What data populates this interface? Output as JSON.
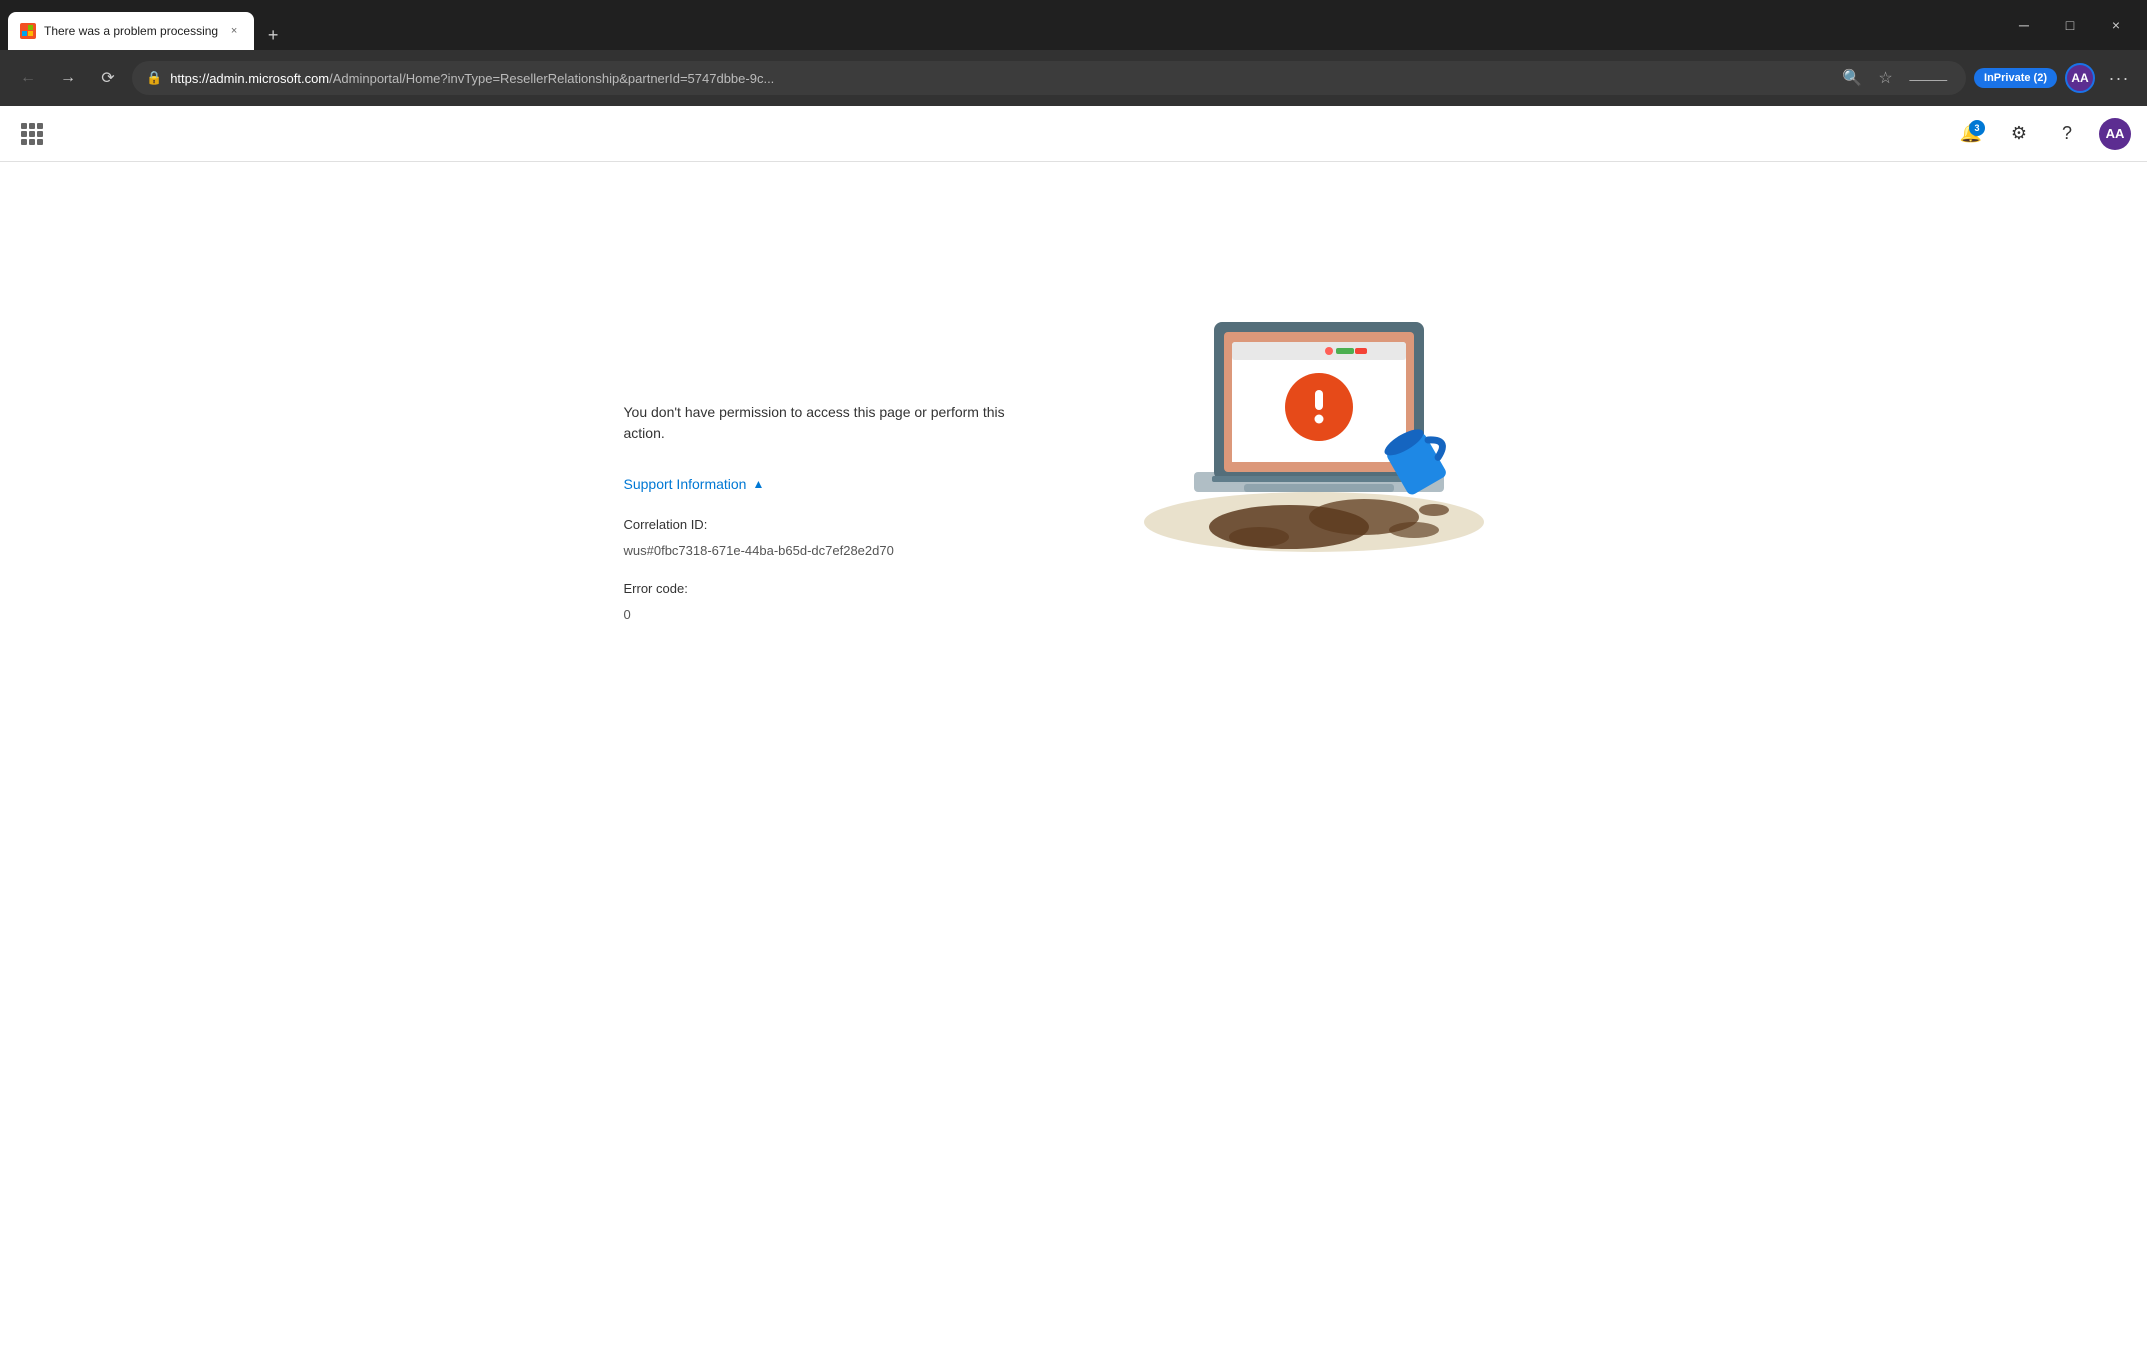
{
  "browser": {
    "title_bar": {
      "tab_title": "There was a problem processing",
      "close_label": "×",
      "minimize_label": "─",
      "maximize_label": "□",
      "new_tab_label": "+"
    },
    "nav_bar": {
      "url": "https://admin.microsoft.com/Adminportal/Home?invType=ResellerRelationship&partnerId=5747dbbe-9c...",
      "url_base": "https://admin.microsoft.com",
      "url_path": "/Adminportal/Home?invType=ResellerRelationship&partnerId=5747dbbe-9c...",
      "inprivate_label": "InPrivate (2)",
      "profile_initials": "AA"
    },
    "app_bar": {
      "notification_count": "3",
      "profile_initials": "AA"
    }
  },
  "page": {
    "error_message": "You don't have permission to access this page or perform this action.",
    "support_info_label": "Support Information",
    "chevron": "▲",
    "correlation_id_label": "Correlation ID:",
    "correlation_id_value": "wus#0fbc7318-671e-44ba-b65d-dc7ef28e2d70",
    "error_code_label": "Error code:",
    "error_code_value": "0"
  },
  "colors": {
    "browser_bg": "#202020",
    "nav_bg": "#323232",
    "accent": "#0078d4",
    "error_orange": "#d84315",
    "tab_active_bg": "#ffffff",
    "inprivate_bg": "#1a73e8"
  }
}
